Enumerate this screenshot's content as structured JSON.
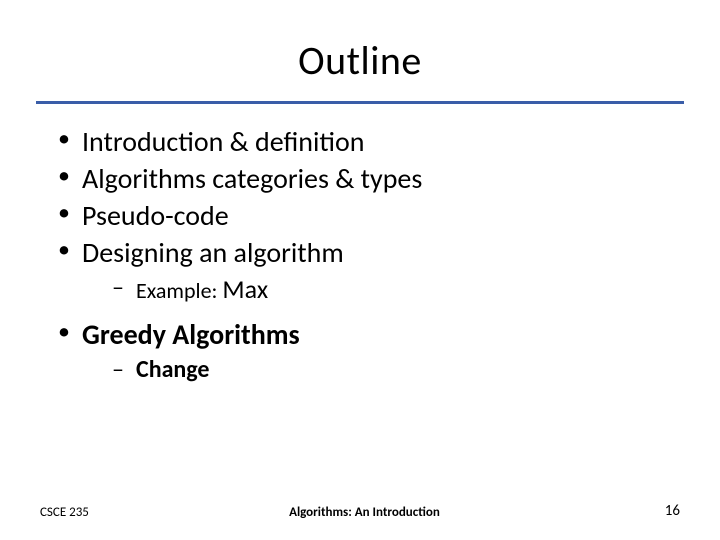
{
  "title": "Outline",
  "bullets": {
    "b1": "Introduction & definition",
    "b2": "Algorithms categories & types",
    "b3": "Pseudo-code",
    "b4": "Designing an algorithm",
    "b4_sub_label": "Example: ",
    "b4_sub_value": "Max",
    "b5": "Greedy Algorithms",
    "b5_sub": "Change"
  },
  "footer": {
    "left": "CSCE 235",
    "center": "Algorithms: An Introduction",
    "right": "16"
  }
}
